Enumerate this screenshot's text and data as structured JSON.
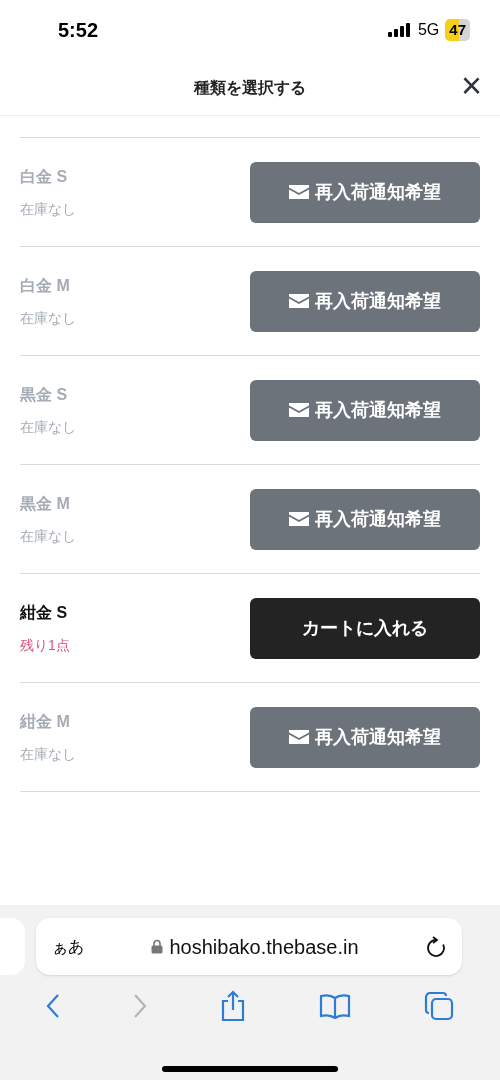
{
  "status_bar": {
    "time": "5:52",
    "network": "5G",
    "battery": "47"
  },
  "header": {
    "title": "種類を選択する",
    "close": "×"
  },
  "variants": [
    {
      "name": "白金 S",
      "stock": "在庫なし",
      "available": false,
      "kind": "notify",
      "button": "再入荷通知希望"
    },
    {
      "name": "白金 M",
      "stock": "在庫なし",
      "available": false,
      "kind": "notify",
      "button": "再入荷通知希望"
    },
    {
      "name": "黒金 S",
      "stock": "在庫なし",
      "available": false,
      "kind": "notify",
      "button": "再入荷通知希望"
    },
    {
      "name": "黒金 M",
      "stock": "在庫なし",
      "available": false,
      "kind": "notify",
      "button": "再入荷通知希望"
    },
    {
      "name": "紺金 S",
      "stock": "残り1点",
      "available": true,
      "kind": "cart",
      "button": "カートに入れる"
    },
    {
      "name": "紺金 M",
      "stock": "在庫なし",
      "available": false,
      "kind": "notify",
      "button": "再入荷通知希望"
    }
  ],
  "browser": {
    "text_size": "ぁあ",
    "url": "hoshibako.thebase.in"
  }
}
